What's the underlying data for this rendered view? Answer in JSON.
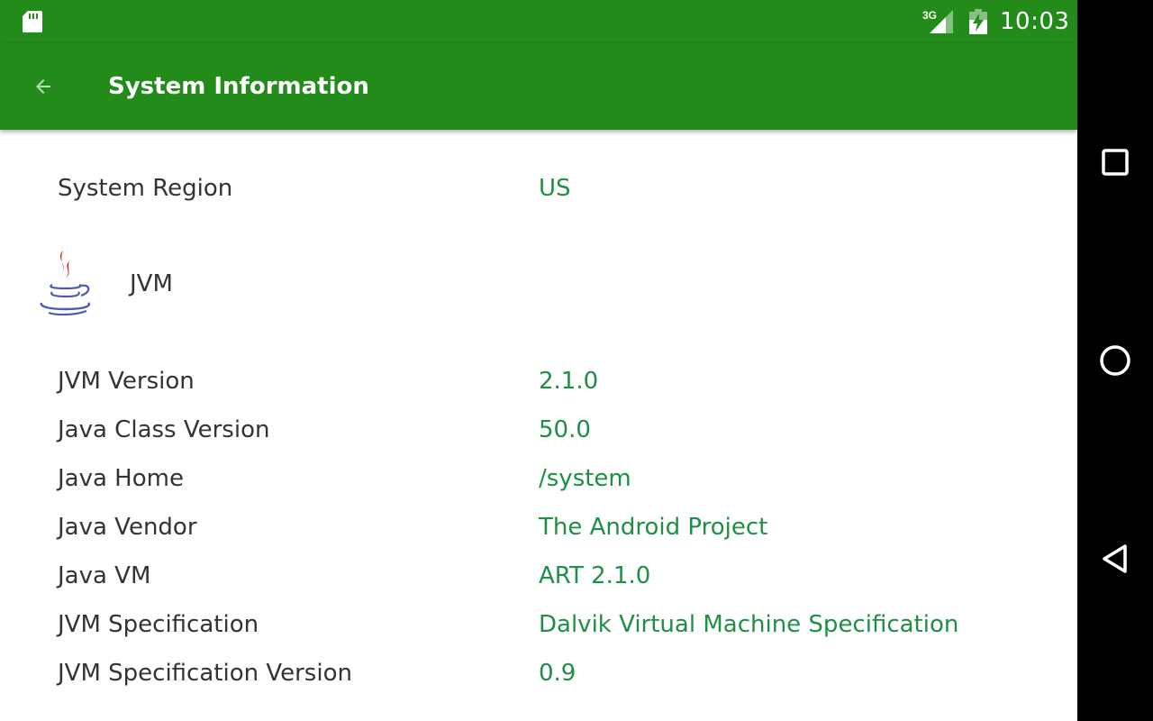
{
  "status_bar": {
    "time": "10:03",
    "network_type": "3G"
  },
  "app_bar": {
    "title": "System Information"
  },
  "region_row": {
    "label": "System Region",
    "value": "US"
  },
  "jvm_section": {
    "title": "JVM",
    "rows": [
      {
        "label": "JVM Version",
        "value": "2.1.0"
      },
      {
        "label": "Java Class Version",
        "value": "50.0"
      },
      {
        "label": "Java Home",
        "value": "/system"
      },
      {
        "label": "Java Vendor",
        "value": "The Android Project"
      },
      {
        "label": "Java VM",
        "value": "ART 2.1.0"
      },
      {
        "label": "JVM Specification",
        "value": "Dalvik Virtual Machine Specification"
      },
      {
        "label": "JVM Specification Version",
        "value": "0.9"
      }
    ]
  },
  "nav_bar": {
    "buttons": [
      "recents-icon",
      "home-icon",
      "back-icon"
    ]
  },
  "colors": {
    "primary": "#228b1a",
    "value_text": "#1e8f45",
    "label_text": "#333333",
    "java_red": "#d9261c",
    "java_blue": "#4a5bb5"
  }
}
